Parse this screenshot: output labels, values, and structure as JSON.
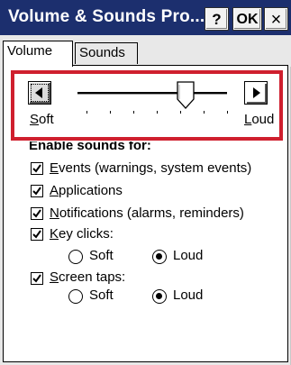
{
  "window": {
    "title": "Volume & Sounds Pro...",
    "help_label": "?",
    "ok_label": "OK",
    "close_label": "×"
  },
  "tabs": [
    {
      "label": "Volume",
      "selected": true
    },
    {
      "label": "Sounds",
      "selected": false
    }
  ],
  "volume": {
    "soft_label_first": "S",
    "soft_label_rest": "oft",
    "loud_label_first": "L",
    "loud_label_rest": "oud",
    "level_fraction": 0.72,
    "tick_count": 7
  },
  "enable_sounds": {
    "heading": "Enable sounds for:",
    "events": {
      "first": "E",
      "rest": "vents (warnings, system events)",
      "checked": true
    },
    "applications": {
      "first": "A",
      "rest": "pplications",
      "checked": true
    },
    "notifications": {
      "first": "N",
      "rest": "otifications (alarms, reminders)",
      "checked": true
    },
    "key_clicks": {
      "first": "K",
      "rest": "ey clicks:",
      "checked": true
    },
    "key_clicks_options": {
      "soft": "Soft",
      "loud": "Loud",
      "selected": "Loud"
    },
    "screen_taps": {
      "first": "S",
      "rest": "creen taps:",
      "checked": true
    },
    "screen_taps_options": {
      "soft": "Soft",
      "loud": "Loud",
      "selected": "Loud"
    }
  },
  "colors": {
    "titlebar": "#1c2f6e",
    "highlight_box": "#cf1f2e"
  },
  "icons": {
    "left_arrow": "triangle-left-icon",
    "right_arrow": "triangle-right-icon",
    "check": "checkmark-icon"
  }
}
